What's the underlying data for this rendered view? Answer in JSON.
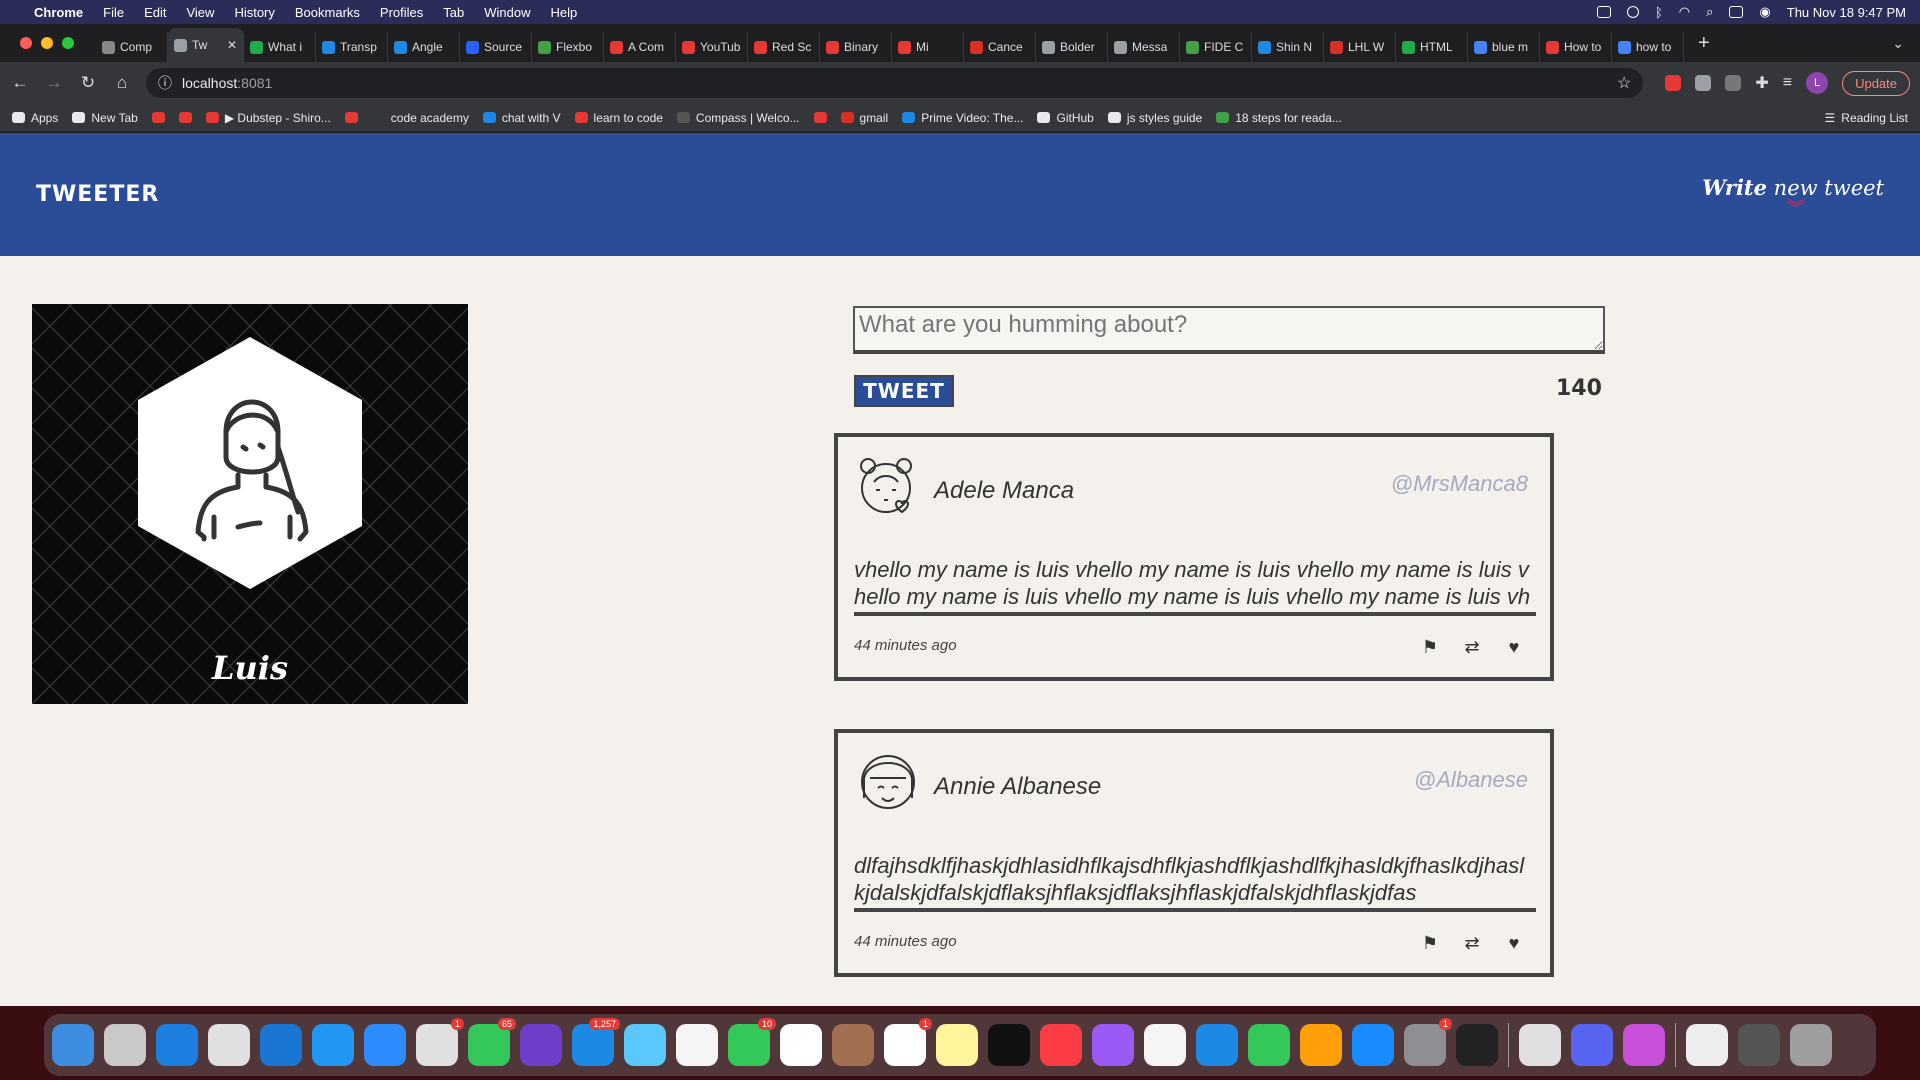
{
  "menubar": {
    "app": "Chrome",
    "items": [
      "File",
      "Edit",
      "View",
      "History",
      "Bookmarks",
      "Profiles",
      "Tab",
      "Window",
      "Help"
    ],
    "clock": "Thu Nov 18  9:47 PM"
  },
  "tabs": [
    {
      "label": "Comp",
      "color": "#888888"
    },
    {
      "label": "Tw",
      "color": "#9aa0a6",
      "active": true
    },
    {
      "label": "What i",
      "color": "#1fae47"
    },
    {
      "label": "Transp",
      "color": "#1e88e5"
    },
    {
      "label": "Angle",
      "color": "#1e88e5"
    },
    {
      "label": "Source",
      "color": "#2962ff"
    },
    {
      "label": "Flexbo",
      "color": "#43a047"
    },
    {
      "label": "A Com",
      "color": "#e53935"
    },
    {
      "label": "YouTub",
      "color": "#e53935"
    },
    {
      "label": "Red Sc",
      "color": "#e53935"
    },
    {
      "label": "Binary",
      "color": "#e53935"
    },
    {
      "label": "Mi",
      "color": "#e53935"
    },
    {
      "label": "Cance",
      "color": "#d93025"
    },
    {
      "label": "Bolder",
      "color": "#9aa0a6"
    },
    {
      "label": "Messa",
      "color": "#9aa0a6"
    },
    {
      "label": "FIDE C",
      "color": "#43a047"
    },
    {
      "label": "Shin N",
      "color": "#1e88e5"
    },
    {
      "label": "LHL W",
      "color": "#d93025"
    },
    {
      "label": "HTML",
      "color": "#1fae47"
    },
    {
      "label": "blue m",
      "color": "#4285f4"
    },
    {
      "label": "How to",
      "color": "#e53935"
    },
    {
      "label": "how to",
      "color": "#4285f4"
    }
  ],
  "toolbar": {
    "url_host": "localhost",
    "url_port": ":8081",
    "profile_initial": "L",
    "update_label": "Update"
  },
  "bookmarks": [
    {
      "label": "Apps",
      "color": "#e8eaed"
    },
    {
      "label": "New Tab",
      "color": "#e8eaed"
    },
    {
      "label": "",
      "color": "#e53935"
    },
    {
      "label": "",
      "color": "#e53935"
    },
    {
      "label": "▶ Dubstep - Shiro...",
      "color": "#e53935"
    },
    {
      "label": "",
      "color": "#e53935"
    },
    {
      "label": "code academy",
      "color": "#35363a"
    },
    {
      "label": "chat with V",
      "color": "#1e88e5"
    },
    {
      "label": "learn to code",
      "color": "#e53935"
    },
    {
      "label": "Compass | Welco...",
      "color": "#555555"
    },
    {
      "label": "",
      "color": "#e53935"
    },
    {
      "label": "gmail",
      "color": "#d93025"
    },
    {
      "label": "Prime Video: The...",
      "color": "#1e88e5"
    },
    {
      "label": "GitHub",
      "color": "#e8eaed"
    },
    {
      "label": "js styles guide",
      "color": "#e8eaed"
    },
    {
      "label": "18 steps for reada...",
      "color": "#43a047"
    }
  ],
  "reading_list": "Reading List",
  "site": {
    "brand": "TWEETER",
    "write_bold": "Write",
    "write_rest": " new tweet",
    "chevron": "︾"
  },
  "profile": {
    "name": "Luis"
  },
  "composer": {
    "placeholder": "What are you humming about?",
    "button": "TWEET",
    "counter": "140"
  },
  "tweets": [
    {
      "author": "Adele Manca",
      "handle": "@MrsManca8",
      "body": "vhello my name is luis vhello my name is luis vhello my name is luis vhello my name is luis vhello my name is luis vhello my name is luis vh",
      "time": "44 minutes ago"
    },
    {
      "author": "Annie Albanese",
      "handle": "@Albanese",
      "body": "dlfajhsdklfjhaskjdhlasidhflkajsdhflkjashdflkjashdlfkjhasldkjfhaslkdjhasl kjdalskjdfalskjdflaksjhflaksjdflaksjhflaskjdfalskjdhflaskjdfas",
      "time": "44 minutes ago"
    }
  ],
  "dock": [
    {
      "color": "#3d8de0"
    },
    {
      "color": "#c9c9c9"
    },
    {
      "color": "#1c7fe0"
    },
    {
      "color": "#e0e0e0"
    },
    {
      "color": "#1976d2"
    },
    {
      "color": "#2196f3"
    },
    {
      "color": "#2d8cff"
    },
    {
      "color": "#e0e0e0",
      "badge": "1"
    },
    {
      "color": "#34c759",
      "badge": "65"
    },
    {
      "color": "#6e40c9"
    },
    {
      "color": "#1e88e5",
      "badge": "1,257"
    },
    {
      "color": "#5ac8fa"
    },
    {
      "color": "#f5f5f5"
    },
    {
      "color": "#34c759",
      "badge": "10"
    },
    {
      "color": "#ffffff"
    },
    {
      "color": "#a07050"
    },
    {
      "color": "#ffffff",
      "badge": "1"
    },
    {
      "color": "#fff59d"
    },
    {
      "color": "#111111"
    },
    {
      "color": "#fc3c44"
    },
    {
      "color": "#9b59f6"
    },
    {
      "color": "#f5f5f5"
    },
    {
      "color": "#1e88e5"
    },
    {
      "color": "#34c759"
    },
    {
      "color": "#ff9f0a"
    },
    {
      "color": "#1a8cff"
    },
    {
      "color": "#8e8e93",
      "badge": "1"
    },
    {
      "color": "#222222"
    },
    {
      "color": "#e0e0e0"
    },
    {
      "color": "#5865f2"
    },
    {
      "color": "#c84fd8"
    },
    {
      "color": "#eeeeee"
    },
    {
      "color": "#555555"
    },
    {
      "color": "#9e9e9e"
    }
  ]
}
